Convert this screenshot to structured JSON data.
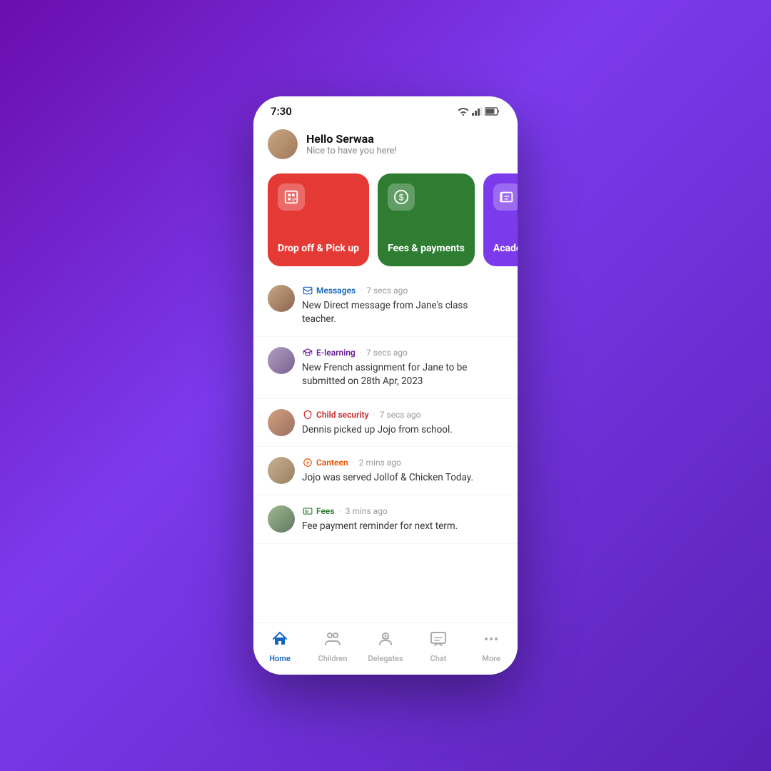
{
  "status": {
    "time": "7:30",
    "wifi": "📶",
    "signal": "📶",
    "battery": "🔋"
  },
  "header": {
    "greeting": "Hello Serwaa",
    "subtitle": "Nice to have you here!"
  },
  "actions": [
    {
      "id": "drop-off",
      "label": "Drop off & Pick up",
      "color": "red",
      "icon": "qr"
    },
    {
      "id": "fees",
      "label": "Fees & payments",
      "color": "green",
      "icon": "money"
    },
    {
      "id": "academics",
      "label": "Academics",
      "color": "purple",
      "icon": "book"
    }
  ],
  "feed": [
    {
      "tag": "Messages",
      "tag_color": "blue",
      "time": "7 secs ago",
      "text": "New Direct message from Jane's class teacher."
    },
    {
      "tag": "E-learning",
      "tag_color": "purple",
      "time": "7 secs ago",
      "text": "New French assignment for Jane to be submitted on 28th Apr, 2023"
    },
    {
      "tag": "Child security",
      "tag_color": "red",
      "time": "7 secs ago",
      "text": "Dennis picked up Jojo from school."
    },
    {
      "tag": "Canteen",
      "tag_color": "orange",
      "time": "2 mins ago",
      "text": "Jojo was served Jollof & Chicken Today."
    },
    {
      "tag": "Fees",
      "tag_color": "green",
      "time": "3 mins ago",
      "text": "Fee payment reminder for next term."
    }
  ],
  "nav": [
    {
      "id": "home",
      "label": "Home",
      "active": true,
      "icon": "home"
    },
    {
      "id": "children",
      "label": "Children",
      "active": false,
      "icon": "children"
    },
    {
      "id": "delegates",
      "label": "Delegates",
      "active": false,
      "icon": "delegates"
    },
    {
      "id": "chat",
      "label": "Chat",
      "active": false,
      "icon": "chat"
    },
    {
      "id": "more",
      "label": "More",
      "active": false,
      "icon": "more"
    }
  ]
}
